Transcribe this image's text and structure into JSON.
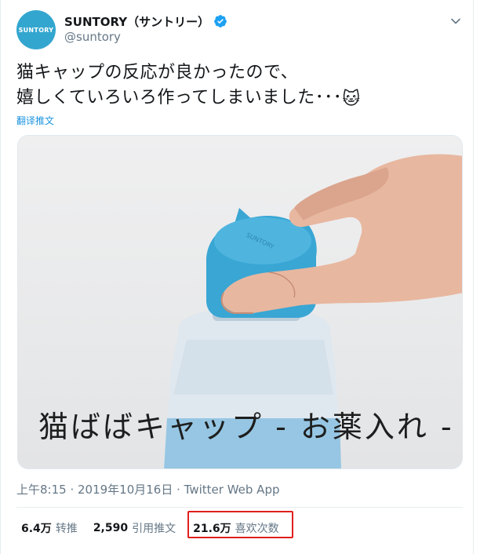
{
  "author": {
    "avatar_text": "SUNTORY",
    "display_name": "SUNTORY（サントリー）",
    "handle": "@suntory",
    "verified": true
  },
  "tweet": {
    "text_line1": "猫キャップの反応が良かったので、",
    "text_line2": "嬉しくていろいろ作ってしまいました･･･",
    "emoji": "🐱",
    "translate_label": "翻译推文"
  },
  "media": {
    "caption": "猫ばばキャップ - お薬入れ -",
    "cap_logo": "SUNTORY"
  },
  "meta": {
    "time": "上午8:15",
    "date": "2019年10月16日",
    "separator": " · ",
    "app": "Twitter Web App"
  },
  "stats": {
    "retweets_count": "6.4万",
    "retweets_label": "转推",
    "quotes_count": "2,590",
    "quotes_label": "引用推文",
    "likes_count": "21.6万",
    "likes_label": "喜欢次数"
  },
  "icons": {
    "verified": "verified-badge-icon",
    "menu": "chevron-down-icon"
  },
  "colors": {
    "brand": "#33a6cf",
    "link": "#1b95e0",
    "highlight": "#e0201c",
    "muted": "#657786"
  }
}
